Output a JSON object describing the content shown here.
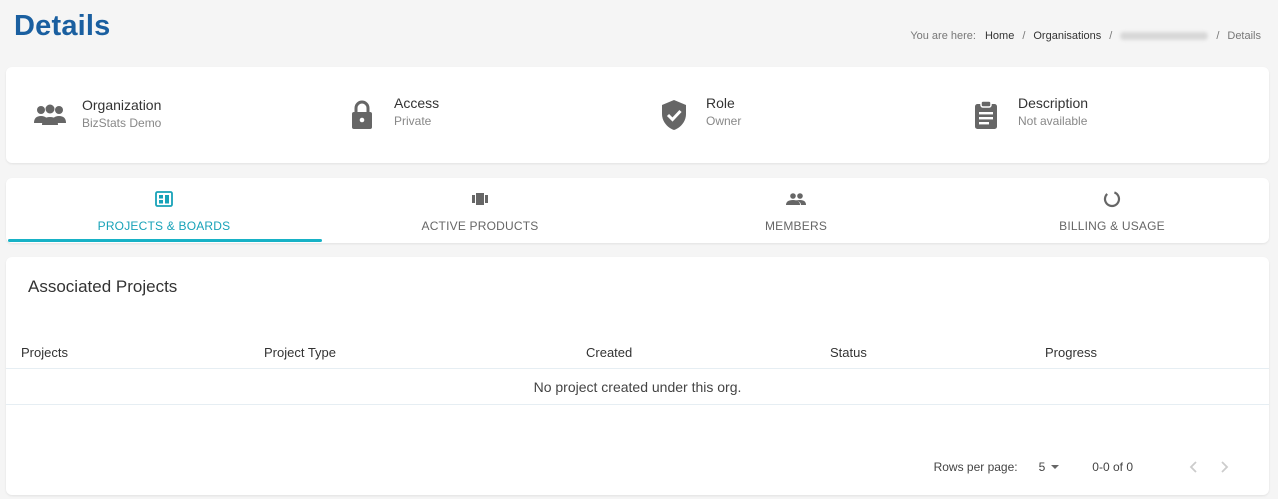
{
  "header": {
    "title": "Details",
    "breadcrumb": {
      "prefix": "You are here:",
      "items": [
        "Home",
        "Organisations"
      ],
      "current": "Details"
    }
  },
  "info": {
    "organization": {
      "label": "Organization",
      "value": "BizStats Demo",
      "icon": "people-group-icon"
    },
    "access": {
      "label": "Access",
      "value": "Private",
      "icon": "lock-icon"
    },
    "role": {
      "label": "Role",
      "value": "Owner",
      "icon": "shield-check-icon"
    },
    "description": {
      "label": "Description",
      "value": "Not available",
      "icon": "clipboard-icon"
    }
  },
  "tabs": [
    {
      "label": "PROJECTS & BOARDS",
      "icon": "dashboard-icon",
      "active": true
    },
    {
      "label": "ACTIVE PRODUCTS",
      "icon": "carousel-icon",
      "active": false
    },
    {
      "label": "MEMBERS",
      "icon": "people-icon",
      "active": false
    },
    {
      "label": "BILLING & USAGE",
      "icon": "donut-icon",
      "active": false
    }
  ],
  "projects": {
    "title": "Associated Projects",
    "columns": [
      "Projects",
      "Project Type",
      "Created",
      "Status",
      "Progress"
    ],
    "empty_message": "No project created under this org."
  },
  "pagination": {
    "rows_per_page_label": "Rows per page:",
    "rows_per_page": "5",
    "range": "0-0 of 0"
  },
  "colors": {
    "title": "#1a5fa0",
    "accent": "#17a2b8",
    "icon": "#666666"
  }
}
